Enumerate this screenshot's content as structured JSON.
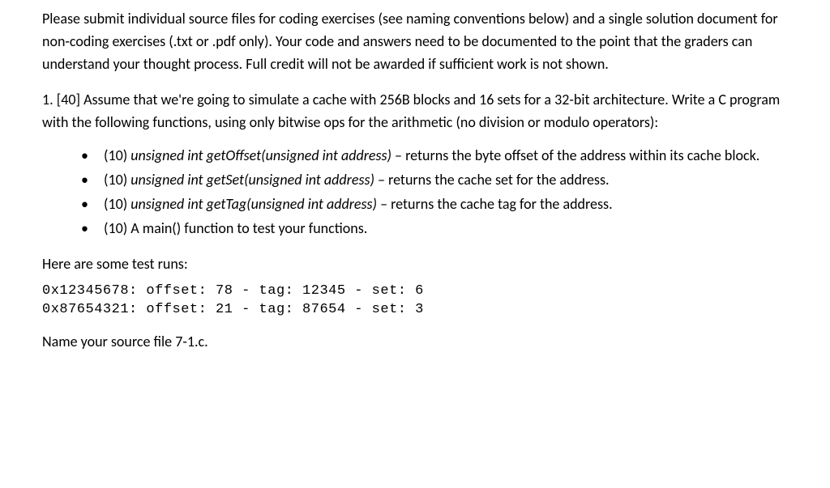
{
  "intro_paragraph": "Please submit individual source files for coding exercises (see naming conventions below) and a single solution document for non-coding exercises (.txt or .pdf only).  Your code and answers need to be documented to the point that the graders can understand your thought process.  Full credit will not be awarded if sufficient work is not shown.",
  "question": {
    "prompt": "1. [40] Assume that we're going to simulate a cache with 256B blocks and 16 sets for a 32-bit architecture.  Write a C program with the following functions, using only bitwise ops for the arithmetic (no division or modulo operators):",
    "bullets": [
      {
        "points": "(10) ",
        "func": "unsigned int getOffset(unsigned int address)",
        "desc": " – returns the byte offset of the address within its cache block."
      },
      {
        "points": "(10) ",
        "func": "unsigned int getSet(unsigned int address)",
        "desc": " – returns the cache set for the address."
      },
      {
        "points": "(10) ",
        "func": "unsigned int getTag(unsigned int address)",
        "desc": " – returns the cache tag for the address."
      },
      {
        "points": "(10) A main() function to test your functions.",
        "func": "",
        "desc": ""
      }
    ],
    "test_label": "Here are some test runs:",
    "test_output": "0x12345678: offset: 78 - tag: 12345 - set: 6\n0x87654321: offset: 21 - tag: 87654 - set: 3",
    "file_naming": "Name your source file 7-1.c."
  }
}
